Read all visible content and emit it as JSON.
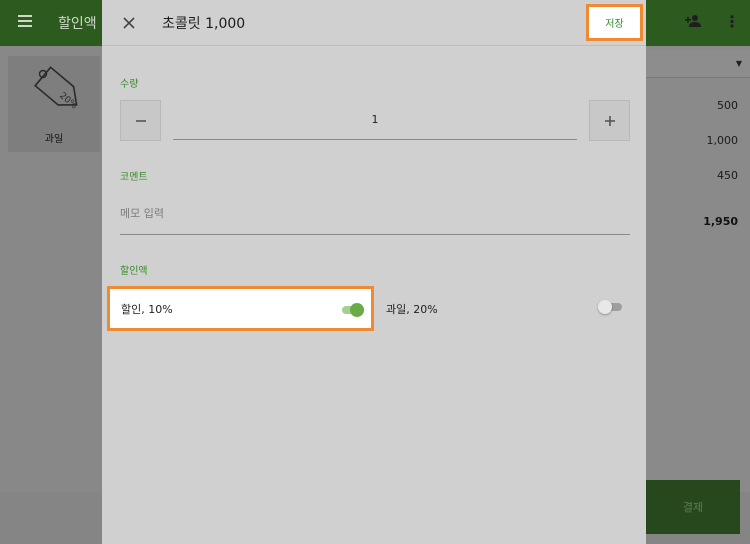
{
  "background": {
    "title": "할인액",
    "product_card": {
      "tag_text": "20%",
      "label": "과일"
    },
    "values": [
      "500",
      "1,000",
      "450"
    ],
    "total": "1,950",
    "pay_label": "결제"
  },
  "dialog": {
    "title": "초콜릿 1,000",
    "save_label": "저장",
    "quantity": {
      "label": "수량",
      "value": "1"
    },
    "comment": {
      "label": "코멘트",
      "placeholder": "메모 입력"
    },
    "discounts": {
      "label": "할인액",
      "items": [
        {
          "label": "할인, 10%",
          "enabled": true
        },
        {
          "label": "과일, 20%",
          "enabled": false
        }
      ]
    }
  },
  "colors": {
    "accent": "#3d8a2f",
    "highlight": "#f08a30",
    "toggle_on": "#69ac45"
  }
}
